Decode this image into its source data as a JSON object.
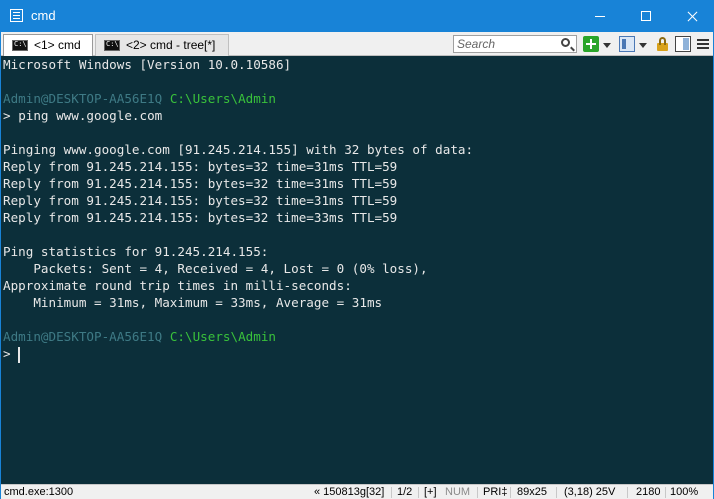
{
  "window": {
    "title": "cmd",
    "accent": "#1883d7"
  },
  "tabs": [
    {
      "label": "<1> cmd",
      "active": true
    },
    {
      "label": "<2> cmd - tree[*]",
      "active": false
    }
  ],
  "search": {
    "placeholder": "Search"
  },
  "toolbar_icons": [
    "search-icon",
    "add-icon",
    "view-icon",
    "lock-icon",
    "split-icon",
    "menu-icon"
  ],
  "console": {
    "background": "#0c2f3a",
    "version_line": "Microsoft Windows [Version 10.0.10586]",
    "prompt_user": "Admin@DESKTOP-AA56E1Q",
    "prompt_path": "C:\\Users\\Admin",
    "prompt_symbol": ">",
    "command": "ping www.google.com",
    "output": [
      "Pinging www.google.com [91.245.214.155] with 32 bytes of data:",
      "Reply from 91.245.214.155: bytes=32 time=31ms TTL=59",
      "Reply from 91.245.214.155: bytes=32 time=31ms TTL=59",
      "Reply from 91.245.214.155: bytes=32 time=31ms TTL=59",
      "Reply from 91.245.214.155: bytes=32 time=33ms TTL=59",
      "",
      "Ping statistics for 91.245.214.155:",
      "    Packets: Sent = 4, Received = 4, Lost = 0 (0% loss),",
      "Approximate round trip times in milli-seconds:",
      "    Minimum = 31ms, Maximum = 33ms, Average = 31ms"
    ]
  },
  "statusbar": {
    "process": "cmd.exe:1300",
    "build": "« 150813g[32]",
    "console_index": "1/2",
    "plus": "[+]",
    "num": "NUM",
    "priority": "PRI‡",
    "size": "89x25",
    "cursor": "(3,18) 25V",
    "pid": "2180",
    "zoom": "100%"
  }
}
